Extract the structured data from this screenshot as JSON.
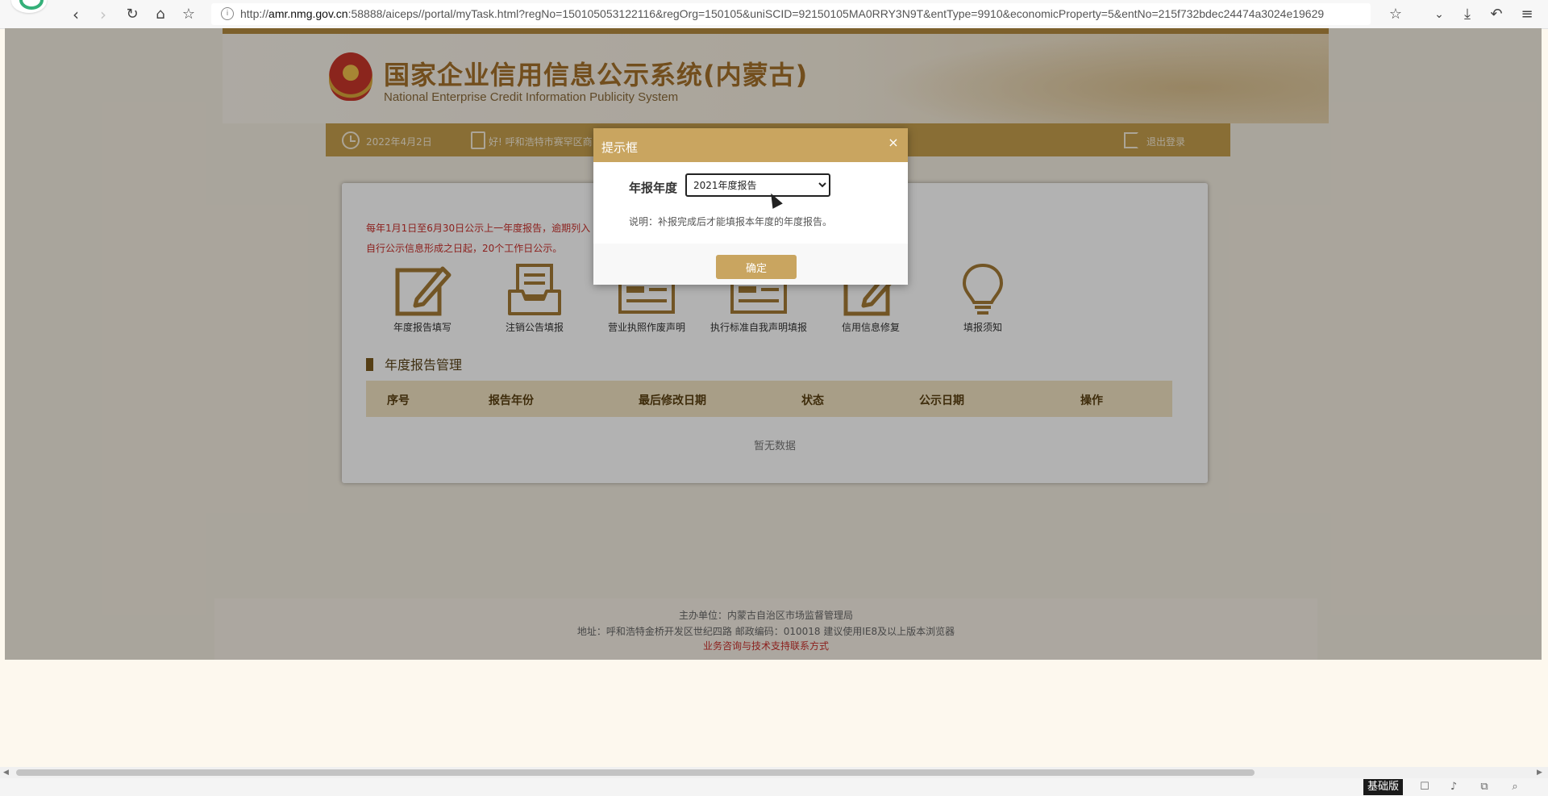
{
  "browser": {
    "url_prefix": "http://",
    "url_host": "amr.nmg.gov.cn",
    "url_rest": ":58888/aiceps//portal/myTask.html?regNo=150105053122116&regOrg=150105&uniSCID=92150105MA0RRY3N9T&entType=9910&economicProperty=5&entNo=215f732bdec24474a3024e19629",
    "mode_label": "基础版"
  },
  "header": {
    "title": "国家企业信用信息公示系统(内蒙古)",
    "subtitle": "National Enterprise Credit Information Publicity System"
  },
  "nav": {
    "date": "2022年4月2日",
    "greeting": "好! 呼和浩特市赛罕区商",
    "logout": "退出登录"
  },
  "notice": {
    "line1": "每年1月1日至6月30日公示上一年度报告，逾期列入",
    "line2": "自行公示信息形成之日起，20个工作日公示。"
  },
  "features": [
    {
      "label": "年度报告填写"
    },
    {
      "label": "注销公告填报"
    },
    {
      "label": "营业执照作废声明"
    },
    {
      "label": "执行标准自我声明填报"
    },
    {
      "label": "信用信息修复"
    },
    {
      "label": "填报须知"
    }
  ],
  "report_section": {
    "title": "年度报告管理",
    "columns": [
      "序号",
      "报告年份",
      "最后修改日期",
      "状态",
      "公示日期",
      "操作"
    ],
    "empty_text": "暂无数据"
  },
  "footer": {
    "host": "主办单位：内蒙古自治区市场监督管理局",
    "address": "地址：呼和浩特金桥开发区世纪四路    邮政编码：010018    建议使用IE8及以上版本浏览器",
    "contact_link": "业务咨询与技术支持联系方式"
  },
  "dialog": {
    "title": "提示框",
    "close": "×",
    "field_label": "年报年度",
    "selected_year": "2021年度报告",
    "note": "说明：补报完成后才能填报本年度的年度报告。",
    "ok_label": "确定"
  },
  "colors": {
    "brand_gold": "#c59e4d",
    "dialog_gold": "#c9a560",
    "notice_red": "#c9302c",
    "banner_stripe": "#b38a3f"
  }
}
